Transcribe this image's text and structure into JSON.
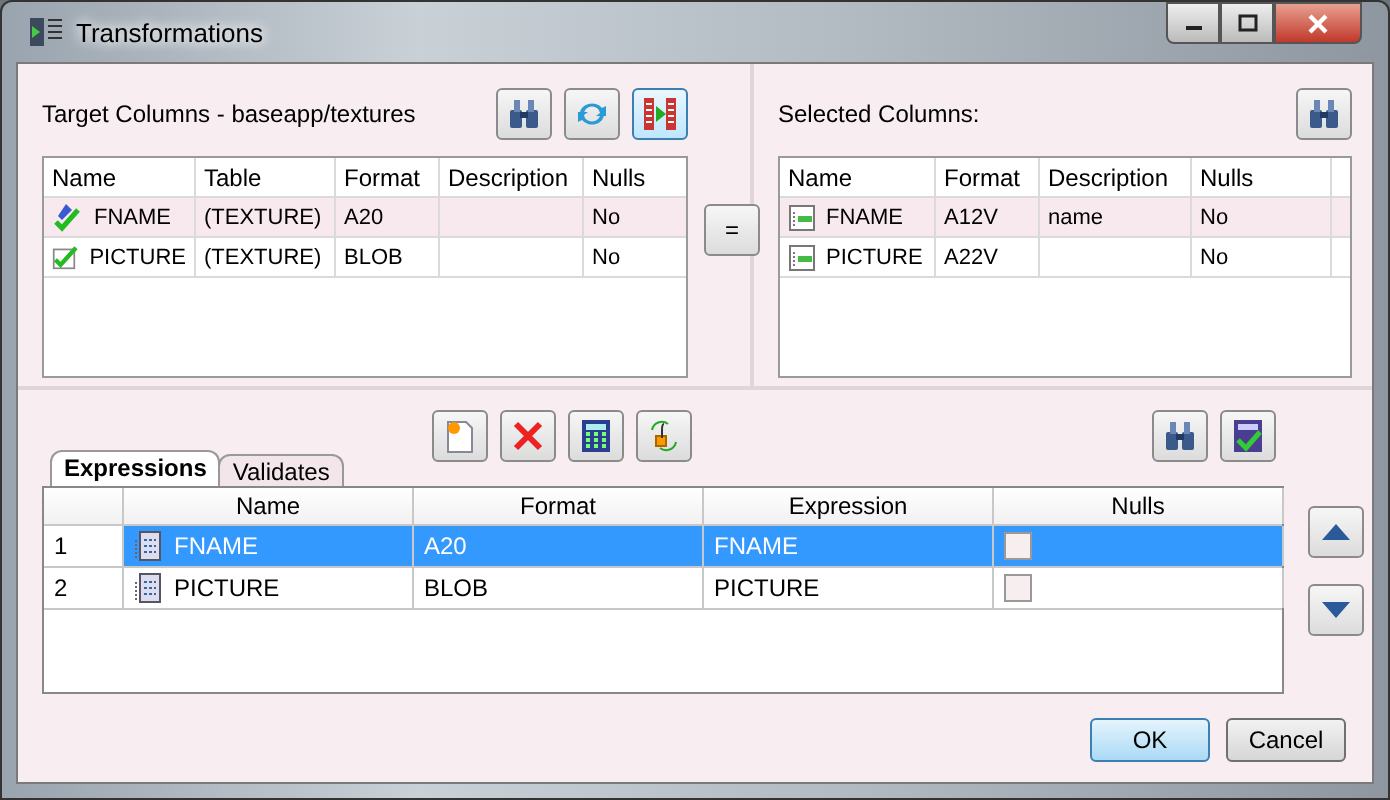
{
  "window": {
    "title": "Transformations"
  },
  "target": {
    "title": "Target Columns - baseapp/textures",
    "tools": [
      {
        "kind": "find",
        "on": false
      },
      {
        "kind": "refresh",
        "on": false
      },
      {
        "kind": "map",
        "on": true
      }
    ],
    "columns": [
      "Name",
      "Table",
      "Format",
      "Description",
      "Nulls"
    ],
    "rows": [
      {
        "kind": "key",
        "selected": true,
        "cells": [
          "FNAME",
          "(TEXTURE)",
          "A20",
          "",
          "No"
        ]
      },
      {
        "kind": "field",
        "selected": false,
        "cells": [
          "PICTURE",
          "(TEXTURE)",
          "BLOB",
          "",
          "No"
        ]
      }
    ]
  },
  "equals_button": "=",
  "selected_columns": {
    "title": "Selected Columns:",
    "tools": [
      {
        "kind": "find",
        "on": false
      }
    ],
    "columns": [
      "Name",
      "Format",
      "Description",
      "Nulls"
    ],
    "rows": [
      {
        "kind": "column",
        "selected": true,
        "cells": [
          "FNAME",
          "A12V",
          "name",
          "No"
        ]
      },
      {
        "kind": "column",
        "selected": false,
        "cells": [
          "PICTURE",
          "A22V",
          "",
          "No"
        ]
      }
    ]
  },
  "expression_tools": [
    {
      "kind": "new"
    },
    {
      "kind": "delete"
    },
    {
      "kind": "calc"
    },
    {
      "kind": "function"
    }
  ],
  "side_tools": [
    {
      "kind": "find"
    },
    {
      "kind": "validate"
    }
  ],
  "tabs": [
    {
      "label": "Expressions",
      "selected": true
    },
    {
      "label": "Validates",
      "selected": false
    }
  ],
  "expressions": {
    "columns": [
      "Name",
      "Format",
      "Expression",
      "Nulls"
    ],
    "rows": [
      {
        "index": "1",
        "name": "FNAME",
        "format": "A20",
        "expression": "FNAME",
        "nulls": false,
        "selected": true
      },
      {
        "index": "2",
        "name": "PICTURE",
        "format": "BLOB",
        "expression": "PICTURE",
        "nulls": false,
        "selected": false
      }
    ]
  },
  "buttons": [
    {
      "label": "OK",
      "default": true
    },
    {
      "label": "Cancel",
      "default": false
    }
  ]
}
